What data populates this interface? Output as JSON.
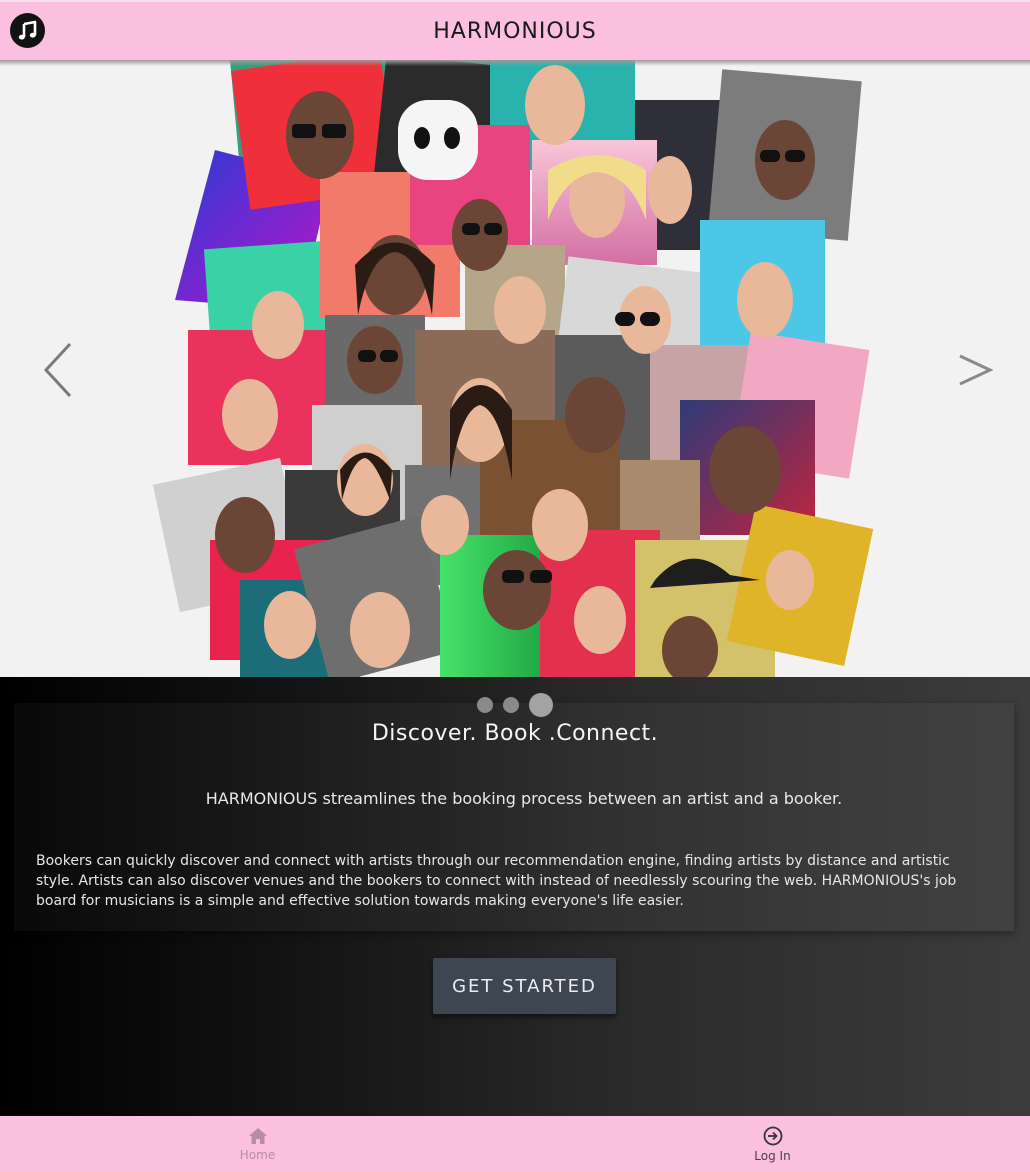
{
  "header": {
    "title": "HARMONIOUS",
    "logo_icon": "music-note-icon"
  },
  "carousel": {
    "prev_icon": "chevron-left-icon",
    "next_symbol": ">",
    "slide_count": 3,
    "active_slide": 3,
    "image_description_icon": "artist-collage"
  },
  "hero": {
    "tagline": "Discover. Book .Connect.",
    "subtitle": "HARMONIOUS streamlines the booking process between an artist and a booker.",
    "description": "Bookers can quickly discover and connect with artists through our recommendation engine, finding artists by distance and artistic style. Artists can also discover venues and the bookers to connect with instead of needlessly scouring the web. HARMONIOUS's job board for musicians is a simple and effective solution towards making everyone's life easier.",
    "cta_label": "GET STARTED"
  },
  "bottom_nav": {
    "items": [
      {
        "label": "Home",
        "icon": "home-icon"
      },
      {
        "label": "Log In",
        "icon": "login-icon"
      }
    ]
  },
  "colors": {
    "header_bg": "#fbbfe0",
    "cta_bg": "#3e4652",
    "content_gradient_start": "#000000",
    "content_gradient_end": "#3c3c3c"
  }
}
